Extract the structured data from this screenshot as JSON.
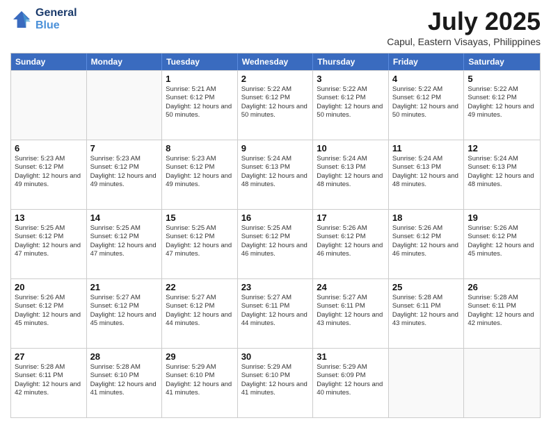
{
  "logo": {
    "line1": "General",
    "line2": "Blue"
  },
  "title": "July 2025",
  "subtitle": "Capul, Eastern Visayas, Philippines",
  "days": [
    "Sunday",
    "Monday",
    "Tuesday",
    "Wednesday",
    "Thursday",
    "Friday",
    "Saturday"
  ],
  "rows": [
    [
      {
        "day": "",
        "empty": true
      },
      {
        "day": "",
        "empty": true
      },
      {
        "day": "1",
        "rise": "Sunrise: 5:21 AM",
        "set": "Sunset: 6:12 PM",
        "daylight": "Daylight: 12 hours and 50 minutes."
      },
      {
        "day": "2",
        "rise": "Sunrise: 5:22 AM",
        "set": "Sunset: 6:12 PM",
        "daylight": "Daylight: 12 hours and 50 minutes."
      },
      {
        "day": "3",
        "rise": "Sunrise: 5:22 AM",
        "set": "Sunset: 6:12 PM",
        "daylight": "Daylight: 12 hours and 50 minutes."
      },
      {
        "day": "4",
        "rise": "Sunrise: 5:22 AM",
        "set": "Sunset: 6:12 PM",
        "daylight": "Daylight: 12 hours and 50 minutes."
      },
      {
        "day": "5",
        "rise": "Sunrise: 5:22 AM",
        "set": "Sunset: 6:12 PM",
        "daylight": "Daylight: 12 hours and 49 minutes."
      }
    ],
    [
      {
        "day": "6",
        "rise": "Sunrise: 5:23 AM",
        "set": "Sunset: 6:12 PM",
        "daylight": "Daylight: 12 hours and 49 minutes."
      },
      {
        "day": "7",
        "rise": "Sunrise: 5:23 AM",
        "set": "Sunset: 6:12 PM",
        "daylight": "Daylight: 12 hours and 49 minutes."
      },
      {
        "day": "8",
        "rise": "Sunrise: 5:23 AM",
        "set": "Sunset: 6:12 PM",
        "daylight": "Daylight: 12 hours and 49 minutes."
      },
      {
        "day": "9",
        "rise": "Sunrise: 5:24 AM",
        "set": "Sunset: 6:13 PM",
        "daylight": "Daylight: 12 hours and 48 minutes."
      },
      {
        "day": "10",
        "rise": "Sunrise: 5:24 AM",
        "set": "Sunset: 6:13 PM",
        "daylight": "Daylight: 12 hours and 48 minutes."
      },
      {
        "day": "11",
        "rise": "Sunrise: 5:24 AM",
        "set": "Sunset: 6:13 PM",
        "daylight": "Daylight: 12 hours and 48 minutes."
      },
      {
        "day": "12",
        "rise": "Sunrise: 5:24 AM",
        "set": "Sunset: 6:13 PM",
        "daylight": "Daylight: 12 hours and 48 minutes."
      }
    ],
    [
      {
        "day": "13",
        "rise": "Sunrise: 5:25 AM",
        "set": "Sunset: 6:12 PM",
        "daylight": "Daylight: 12 hours and 47 minutes."
      },
      {
        "day": "14",
        "rise": "Sunrise: 5:25 AM",
        "set": "Sunset: 6:12 PM",
        "daylight": "Daylight: 12 hours and 47 minutes."
      },
      {
        "day": "15",
        "rise": "Sunrise: 5:25 AM",
        "set": "Sunset: 6:12 PM",
        "daylight": "Daylight: 12 hours and 47 minutes."
      },
      {
        "day": "16",
        "rise": "Sunrise: 5:25 AM",
        "set": "Sunset: 6:12 PM",
        "daylight": "Daylight: 12 hours and 46 minutes."
      },
      {
        "day": "17",
        "rise": "Sunrise: 5:26 AM",
        "set": "Sunset: 6:12 PM",
        "daylight": "Daylight: 12 hours and 46 minutes."
      },
      {
        "day": "18",
        "rise": "Sunrise: 5:26 AM",
        "set": "Sunset: 6:12 PM",
        "daylight": "Daylight: 12 hours and 46 minutes."
      },
      {
        "day": "19",
        "rise": "Sunrise: 5:26 AM",
        "set": "Sunset: 6:12 PM",
        "daylight": "Daylight: 12 hours and 45 minutes."
      }
    ],
    [
      {
        "day": "20",
        "rise": "Sunrise: 5:26 AM",
        "set": "Sunset: 6:12 PM",
        "daylight": "Daylight: 12 hours and 45 minutes."
      },
      {
        "day": "21",
        "rise": "Sunrise: 5:27 AM",
        "set": "Sunset: 6:12 PM",
        "daylight": "Daylight: 12 hours and 45 minutes."
      },
      {
        "day": "22",
        "rise": "Sunrise: 5:27 AM",
        "set": "Sunset: 6:12 PM",
        "daylight": "Daylight: 12 hours and 44 minutes."
      },
      {
        "day": "23",
        "rise": "Sunrise: 5:27 AM",
        "set": "Sunset: 6:11 PM",
        "daylight": "Daylight: 12 hours and 44 minutes."
      },
      {
        "day": "24",
        "rise": "Sunrise: 5:27 AM",
        "set": "Sunset: 6:11 PM",
        "daylight": "Daylight: 12 hours and 43 minutes."
      },
      {
        "day": "25",
        "rise": "Sunrise: 5:28 AM",
        "set": "Sunset: 6:11 PM",
        "daylight": "Daylight: 12 hours and 43 minutes."
      },
      {
        "day": "26",
        "rise": "Sunrise: 5:28 AM",
        "set": "Sunset: 6:11 PM",
        "daylight": "Daylight: 12 hours and 42 minutes."
      }
    ],
    [
      {
        "day": "27",
        "rise": "Sunrise: 5:28 AM",
        "set": "Sunset: 6:11 PM",
        "daylight": "Daylight: 12 hours and 42 minutes."
      },
      {
        "day": "28",
        "rise": "Sunrise: 5:28 AM",
        "set": "Sunset: 6:10 PM",
        "daylight": "Daylight: 12 hours and 41 minutes."
      },
      {
        "day": "29",
        "rise": "Sunrise: 5:29 AM",
        "set": "Sunset: 6:10 PM",
        "daylight": "Daylight: 12 hours and 41 minutes."
      },
      {
        "day": "30",
        "rise": "Sunrise: 5:29 AM",
        "set": "Sunset: 6:10 PM",
        "daylight": "Daylight: 12 hours and 41 minutes."
      },
      {
        "day": "31",
        "rise": "Sunrise: 5:29 AM",
        "set": "Sunset: 6:09 PM",
        "daylight": "Daylight: 12 hours and 40 minutes."
      },
      {
        "day": "",
        "empty": true
      },
      {
        "day": "",
        "empty": true
      }
    ]
  ]
}
